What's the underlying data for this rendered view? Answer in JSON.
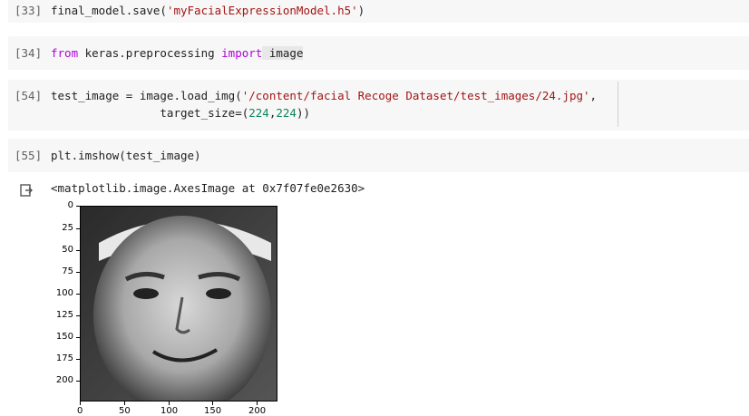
{
  "cells": [
    {
      "prompt": "[33]",
      "code_parts": [
        "final_model.save(",
        "'myFacialExpressionModel.h5'",
        ")"
      ]
    },
    {
      "prompt": "[34]",
      "code_parts": [
        "from",
        " keras.preprocessing ",
        "import",
        " image"
      ]
    },
    {
      "prompt": "[54]",
      "line1_parts": [
        "test_image = image.load_img(",
        "'/content/facial Recoge Dataset/test_images/24.jpg'",
        ","
      ],
      "line2_parts": [
        "                target_size=(",
        "224",
        ",",
        "224",
        "))"
      ]
    },
    {
      "prompt": "[55]",
      "code_parts": [
        "plt.imshow(test_image)"
      ]
    }
  ],
  "output": {
    "text": "<matplotlib.image.AxesImage at 0x7f07fe0e2630>",
    "icon": "output-redirect-icon"
  },
  "plot": {
    "y_ticks": [
      "0",
      "25",
      "50",
      "75",
      "100",
      "125",
      "150",
      "175",
      "200"
    ],
    "x_ticks": [
      "0",
      "50",
      "100",
      "150",
      "200"
    ],
    "image_description_icon": "grayscale-face-image"
  }
}
